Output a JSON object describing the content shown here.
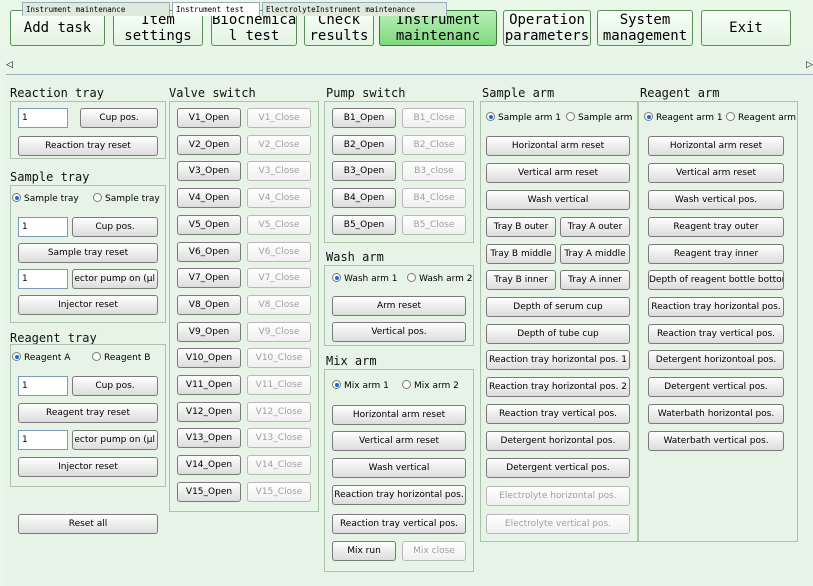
{
  "toolbar": {
    "add_task": "Add task",
    "item_settings": "Item\nsettings",
    "biochemical_test": "Biochemica\nl test",
    "check_results": "Check\nresults",
    "instrument_maintenance": "Instrument\nmaintenanc",
    "operation_parameters": "Operation\nparameters",
    "system_management": "System\nmanagement",
    "exit": "Exit"
  },
  "tabs": {
    "left_arrow": "◁",
    "right_arrow": "▷",
    "t1": "Instrument maintenance",
    "t2": "Instrument test",
    "t3": "ElectrolyteInstrument maintenance"
  },
  "reaction_tray": {
    "title": "Reaction tray",
    "input_value": "1",
    "cup_pos": "Cup pos.",
    "reset": "Reaction tray reset"
  },
  "sample_tray": {
    "title": "Sample tray",
    "radio1": "Sample tray",
    "radio2": "Sample tray",
    "input_value": "1",
    "cup_pos": "Cup pos.",
    "reset": "Sample tray reset",
    "pump_value": "1",
    "pump_label": "ector pump on (µl",
    "injector_reset": "Injector reset"
  },
  "reagent_tray": {
    "title": "Reagent tray",
    "radio1": "Reagent A",
    "radio2": "Reagent B",
    "input_value": "1",
    "cup_pos": "Cup pos.",
    "reset": "Reagent tray reset",
    "pump_value": "1",
    "pump_label": "ector pump on (µl",
    "injector_reset": "Injector reset"
  },
  "reset_all": "Reset all",
  "valve_switch": {
    "title": "Valve switch",
    "rows": [
      {
        "open": "V1_Open",
        "close": "V1_Close"
      },
      {
        "open": "V2_Open",
        "close": "V2_Close"
      },
      {
        "open": "V3_Open",
        "close": "V3_Close"
      },
      {
        "open": "V4_Open",
        "close": "V4_Close"
      },
      {
        "open": "V5_Open",
        "close": "V5_Close"
      },
      {
        "open": "V6_Open",
        "close": "V6_Close"
      },
      {
        "open": "V7_Open",
        "close": "V7_Close"
      },
      {
        "open": "V8_Open",
        "close": "V8_Close"
      },
      {
        "open": "V9_Open",
        "close": "V9_Close"
      },
      {
        "open": "V10_Open",
        "close": "V10_Close"
      },
      {
        "open": "V11_Open",
        "close": "V11_Close"
      },
      {
        "open": "V12_Open",
        "close": "V12_Close"
      },
      {
        "open": "V13_Open",
        "close": "V13_Close"
      },
      {
        "open": "V14_Open",
        "close": "V14_Close"
      },
      {
        "open": "V15_Open",
        "close": "V15_Close"
      }
    ]
  },
  "pump_switch": {
    "title": "Pump switch",
    "rows": [
      {
        "open": "B1_Open",
        "close": "B1_Close"
      },
      {
        "open": "B2_Open",
        "close": "B2_Close"
      },
      {
        "open": "B3_Open",
        "close": "B3_close"
      },
      {
        "open": "B4_Open",
        "close": "B4_Close"
      },
      {
        "open": "B5_Open",
        "close": "B5_Close"
      }
    ]
  },
  "wash_arm": {
    "title": "Wash arm",
    "radio1": "Wash arm 1",
    "radio2": "Wash arm 2",
    "arm_reset": "Arm reset",
    "vertical_pos": "Vertical pos."
  },
  "mix_arm": {
    "title": "Mix arm",
    "radio1": "Mix arm 1",
    "radio2": "Mix arm 2",
    "horizontal_reset": "Horizontal arm reset",
    "vertical_reset": "Vertical arm reset",
    "wash_vertical": "Wash vertical",
    "reaction_horizontal": "Reaction tray horizontal pos.",
    "reaction_vertical": "Reaction tray vertical pos.",
    "mix_run": "Mix run",
    "mix_close": "Mix close"
  },
  "sample_arm": {
    "title": "Sample arm",
    "radio1": "Sample arm 1",
    "radio2": "Sample arm",
    "horizontal_reset": "Horizontal arm reset",
    "vertical_reset": "Vertical arm reset",
    "wash_vertical": "Wash vertical",
    "tray_b_outer": "Tray B outer",
    "tray_a_outer": "Tray A outer",
    "tray_b_middle": "Tray B middle",
    "tray_a_middle": "Tray A middle",
    "tray_b_inner": "Tray B inner",
    "tray_a_inner": "Tray A inner",
    "serum_cup": "Depth of serum cup",
    "tube_cup": "Depth of tube cup",
    "reaction_h1": "Reaction tray horizontal pos. 1",
    "reaction_h2": "Reaction tray horizontal pos. 2",
    "reaction_v": "Reaction tray vertical pos.",
    "detergent_h": "Detergent horizontal pos.",
    "detergent_v": "Detergent vertical pos.",
    "electrolyte_h": "Electrolyte horizontal pos.",
    "electrolyte_v": "Electrolyte vertical pos."
  },
  "reagent_arm": {
    "title": "Reagent arm",
    "radio1": "Reagent arm 1",
    "radio2": "Reagent arm",
    "horizontal_reset": "Horizontal arm reset",
    "vertical_reset": "Vertical arm reset",
    "wash_vertical": "Wash vertical pos.",
    "tray_outer": "Reagent tray outer",
    "tray_inner": "Reagent tray inner",
    "bottle_bottom": "Depth of reagent bottle bottom",
    "reaction_h": "Reaction tray horizontal pos.",
    "reaction_v": "Reaction tray vertical pos.",
    "detergent_h": "Detergent horizontoal pos.",
    "detergent_v": "Detergent vertical pos.",
    "waterbath_h": "Waterbath horizontal pos.",
    "waterbath_v": "Waterbath vertical pos."
  }
}
